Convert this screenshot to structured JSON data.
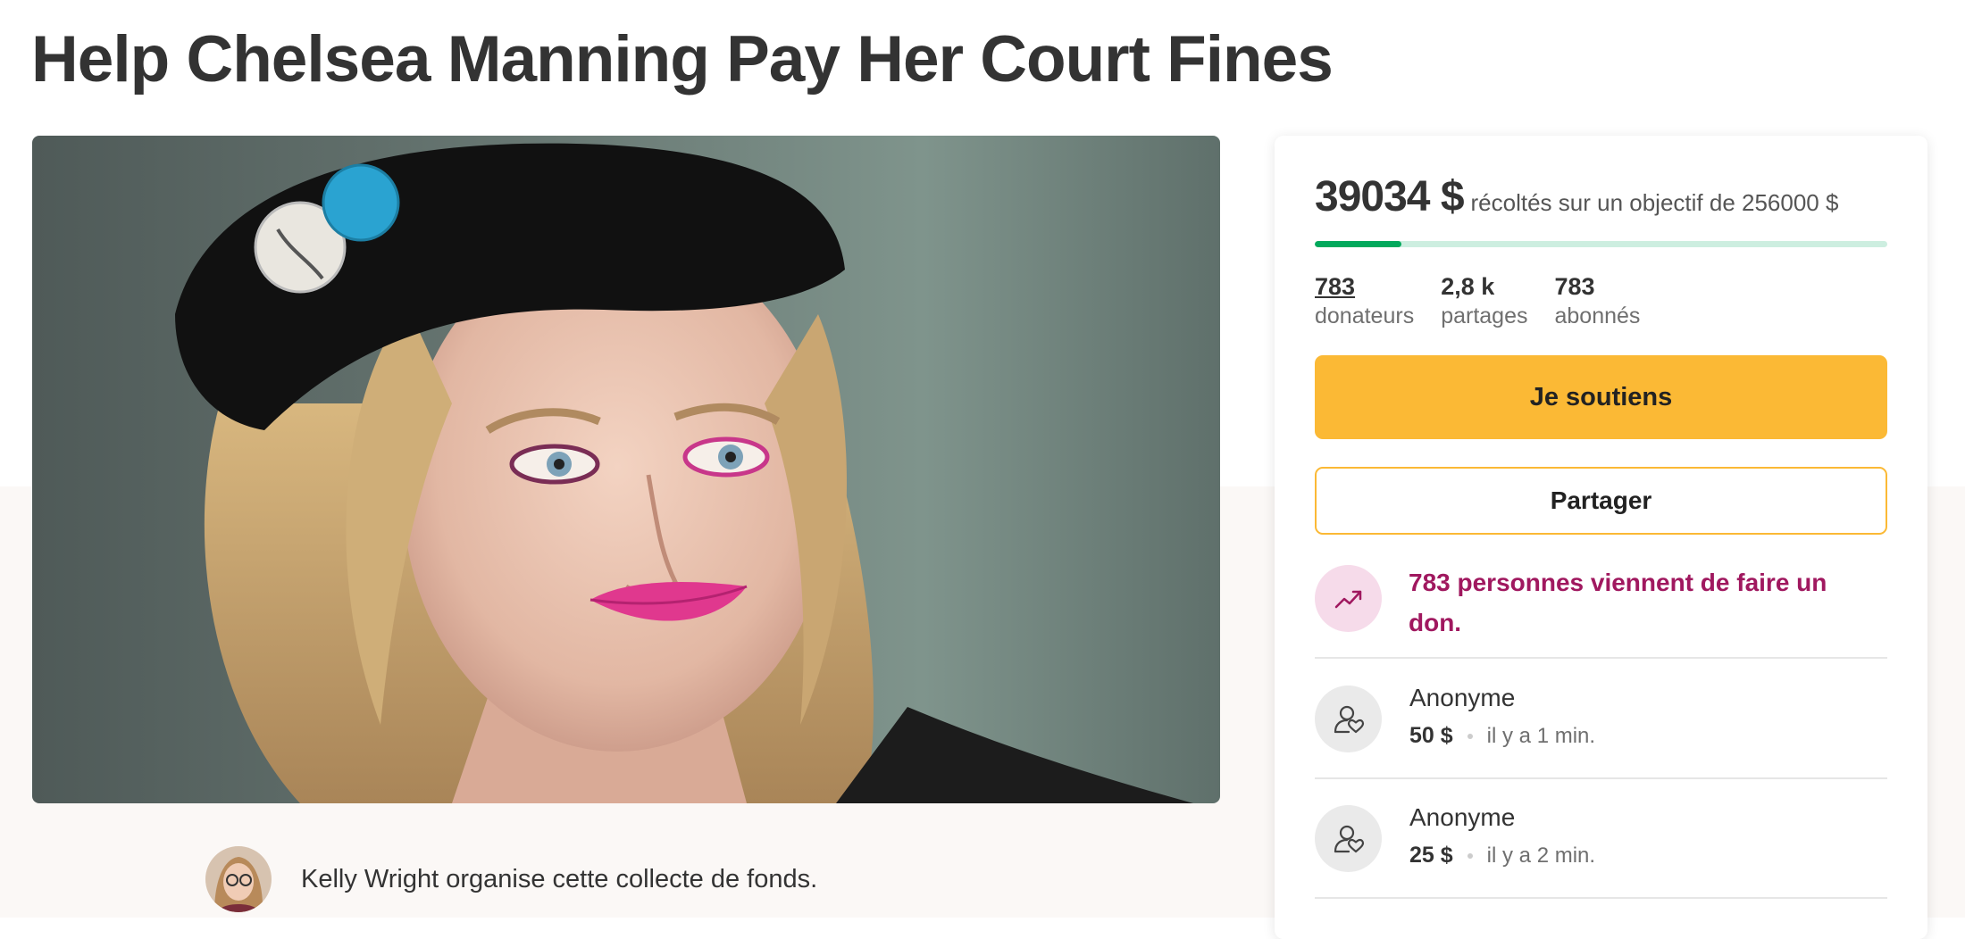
{
  "page": {
    "title": "Help Chelsea Manning Pay Her Court Fines"
  },
  "organizer": {
    "text": "Kelly Wright organise cette collecte de fonds."
  },
  "campaign": {
    "raised": "39034 $",
    "goal_text": "récoltés sur un objectif de 256000 $",
    "progress_fraction": 0.152
  },
  "stats": [
    {
      "value": "783",
      "label": "donateurs"
    },
    {
      "value": "2,8 k",
      "label": "partages"
    },
    {
      "value": "783",
      "label": "abonnés"
    }
  ],
  "actions": {
    "donate_label": "Je soutiens",
    "share_label": "Partager"
  },
  "trend": {
    "text": "783 personnes viennent de faire un don."
  },
  "donations": [
    {
      "name": "Anonyme",
      "amount": "50 $",
      "time": "il y a 1 min."
    },
    {
      "name": "Anonyme",
      "amount": "25 $",
      "time": "il y a 2 min."
    }
  ],
  "icons": {
    "trend": "trending-up-icon",
    "donor": "user-heart-icon"
  },
  "colors": {
    "accent_button": "#fbb935",
    "progress": "#02a95c",
    "progress_track": "#cdeee0",
    "trend_text": "#a0185f",
    "trend_badge": "#f6dbea"
  }
}
